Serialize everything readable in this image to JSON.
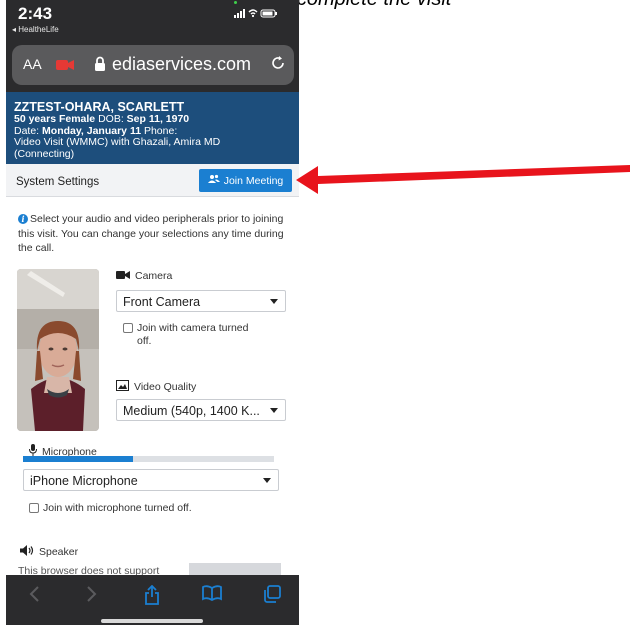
{
  "caption": "the camera and microphone to complete the visit",
  "status_bar": {
    "time": "2:43",
    "back_label": "◂ HealtheLife",
    "icons": "signal-wifi-battery"
  },
  "browser": {
    "text_size_label": "AA",
    "url": "ediaservices.com",
    "reload_icon": "reload-icon"
  },
  "patient": {
    "name": "ZZTEST-OHARA, SCARLETT",
    "age_sex": "50 years Female",
    "dob_label": "DOB:",
    "dob": "Sep 11, 1970",
    "date_label": "Date:",
    "date": "Monday, January 11",
    "phone_label": "Phone:",
    "visit": "Video Visit (WMMC) with Ghazali, Amira MD",
    "status": "(Connecting)"
  },
  "settings": {
    "title": "System Settings",
    "join_label": "Join Meeting"
  },
  "intro_text": "Select your audio and video peripherals prior to joining this visit. You can change your selections any time during the call.",
  "camera": {
    "label": "Camera",
    "selected": "Front Camera",
    "join_off_line1": "Join with camera turned",
    "join_off_line2": "off."
  },
  "video_quality": {
    "label": "Video Quality",
    "selected": "Medium (540p, 1400 K..."
  },
  "microphone": {
    "label": "Microphone",
    "level": 0.44,
    "selected": "iPhone Microphone",
    "join_off": "Join with microphone turned off."
  },
  "speaker": {
    "label": "Speaker",
    "truncated_text": "This browser does not support"
  },
  "colors": {
    "banner": "#1d4e7c",
    "accent": "#1b7fd1",
    "arrow": "#e8141c",
    "toolbar": "#2b2b2d"
  }
}
